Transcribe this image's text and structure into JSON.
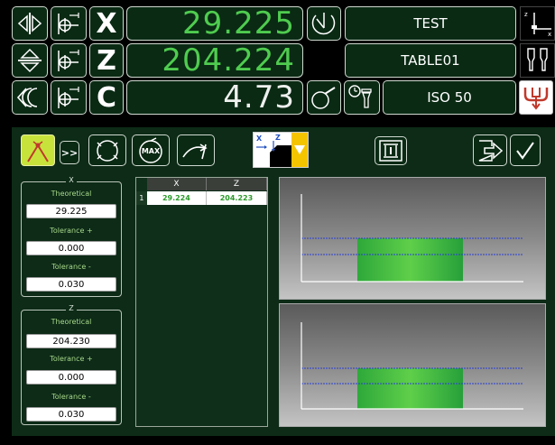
{
  "axes": [
    {
      "letter": "X",
      "value": "29.225",
      "tool_name": "TEST"
    },
    {
      "letter": "Z",
      "value": "204.224",
      "tool_name": "TABLE01"
    },
    {
      "letter": "C",
      "value": "4.73",
      "tool_name": "ISO 50"
    }
  ],
  "toolbar": {
    "max_label": "MAX",
    "more_label": ">>",
    "axis_small_x": "X",
    "axis_small_z": "Z"
  },
  "groups": [
    {
      "title": "X",
      "theoretical_label": "Theoretical",
      "theoretical": "29.225",
      "tol_plus_label": "Tolerance +",
      "tol_plus": "0.000",
      "tol_minus_label": "Tolerance -",
      "tol_minus": "0.030"
    },
    {
      "title": "Z",
      "theoretical_label": "Theoretical",
      "theoretical": "204.230",
      "tol_plus_label": "Tolerance +",
      "tol_plus": "0.000",
      "tol_minus_label": "Tolerance -",
      "tol_minus": "0.030"
    }
  ],
  "table": {
    "headers": [
      "X",
      "Z"
    ],
    "rows": [
      {
        "index": "1",
        "x": "29.224",
        "z": "204.223"
      }
    ]
  },
  "colors": {
    "accent_green": "#4fcc4f",
    "selected_yellow": "#c8e23c",
    "dropdown_yellow": "#f5c400",
    "panel_bg": "#0d2b17"
  }
}
